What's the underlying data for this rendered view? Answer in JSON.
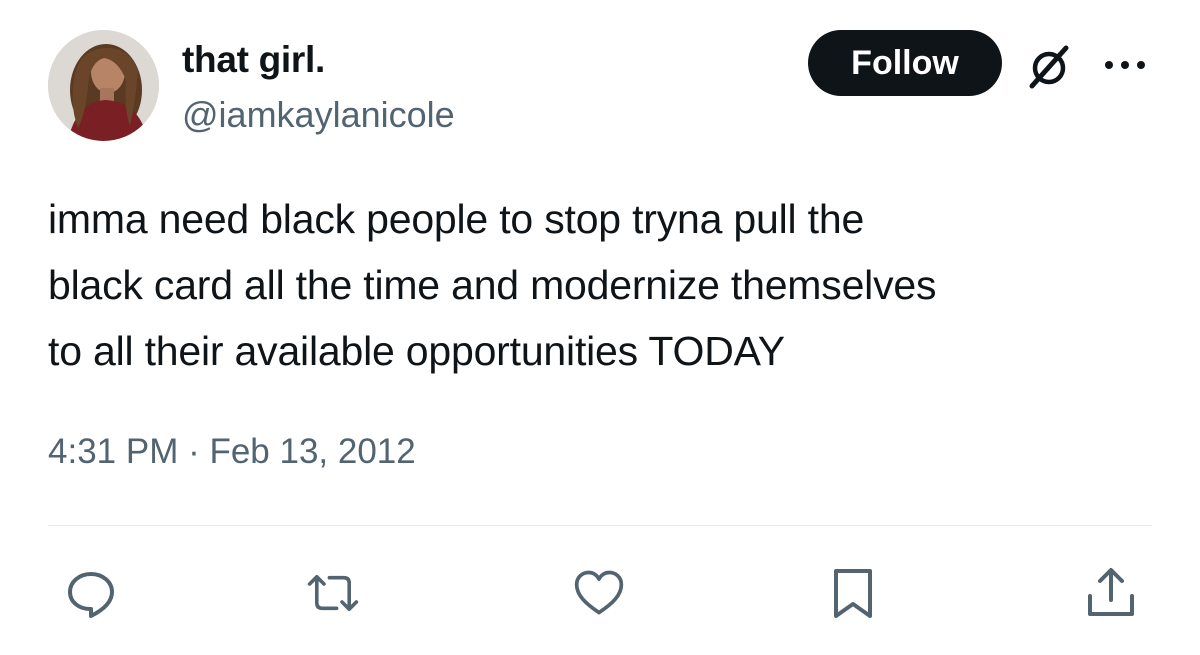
{
  "author": {
    "display_name": "that girl.",
    "handle": "@iamkaylanicole"
  },
  "header": {
    "follow_label": "Follow",
    "icons": [
      "avatar",
      "grok-icon",
      "more-icon"
    ]
  },
  "tweet": {
    "text": "imma need black people to stop tryna pull the\nblack card all the time and modernize themselves\nto all their available opportunities TODAY",
    "timestamp": "4:31 PM · Feb 13, 2012"
  },
  "actions": {
    "icons": [
      "reply-icon",
      "retweet-icon",
      "like-icon",
      "bookmark-icon",
      "share-icon"
    ]
  },
  "colors": {
    "text": "#0f1419",
    "secondary": "#536471",
    "button_bg": "#0f1419",
    "icon": "#536471",
    "divider": "#e6e9ea"
  }
}
